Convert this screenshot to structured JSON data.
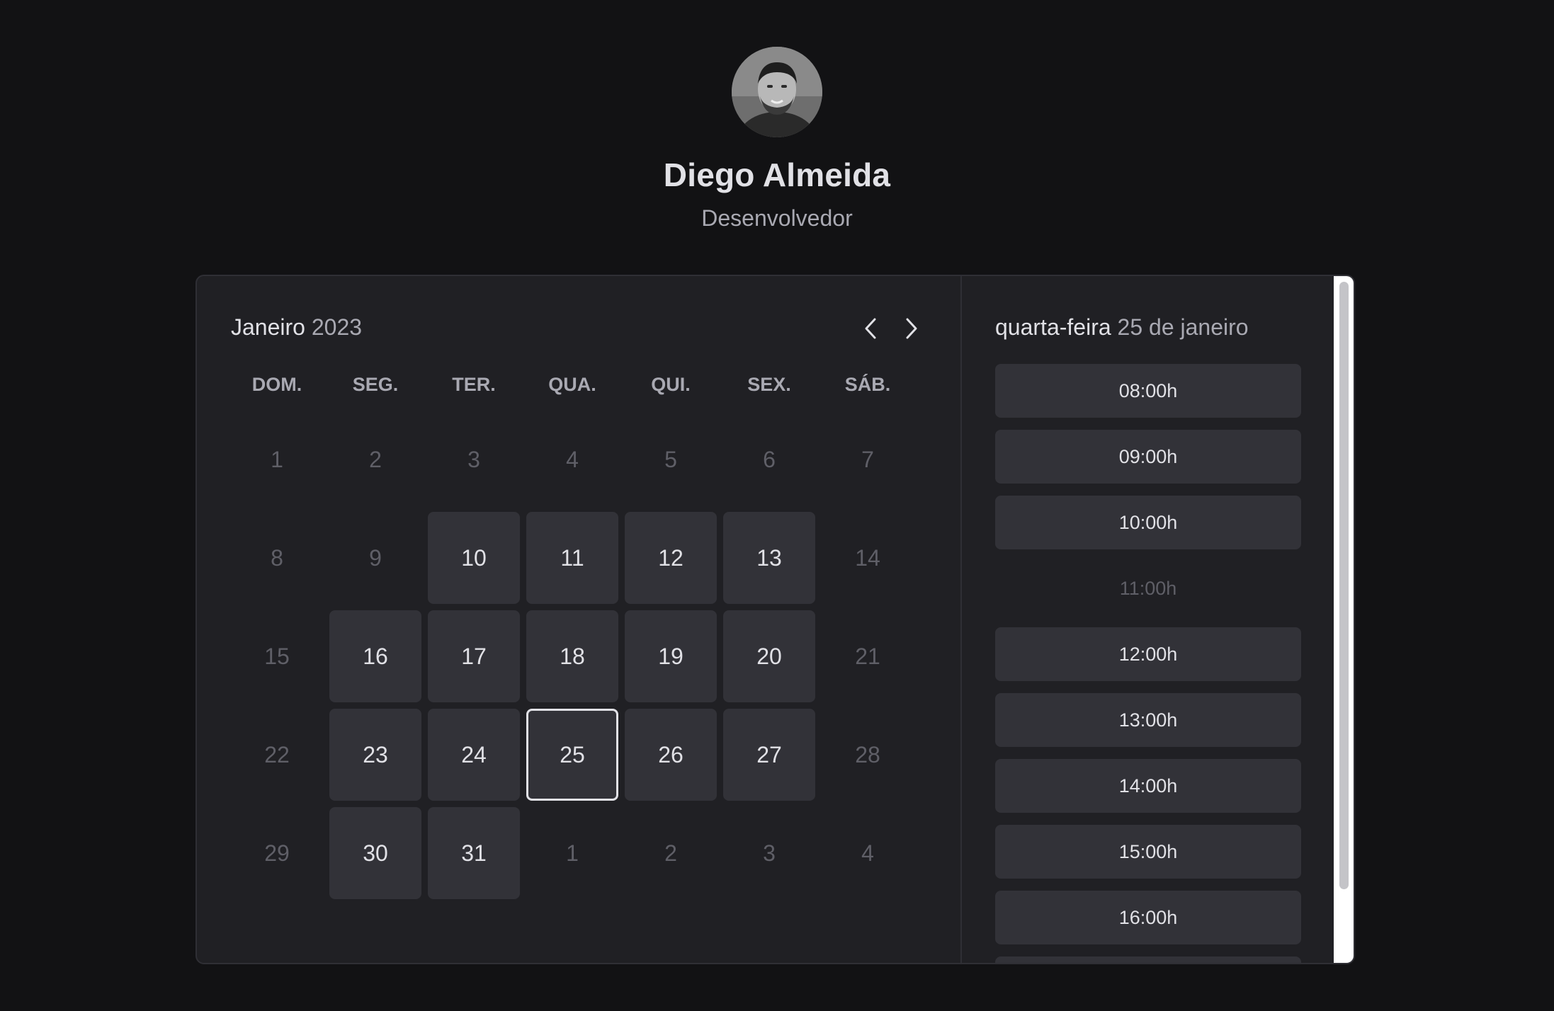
{
  "profile": {
    "name": "Diego Almeida",
    "role": "Desenvolvedor"
  },
  "calendar": {
    "month": "Janeiro",
    "year": "2023",
    "weekdays": [
      "DOM.",
      "SEG.",
      "TER.",
      "QUA.",
      "QUI.",
      "SEX.",
      "SÁB."
    ],
    "weeks": [
      [
        {
          "d": "1",
          "s": "disabled"
        },
        {
          "d": "2",
          "s": "disabled"
        },
        {
          "d": "3",
          "s": "disabled"
        },
        {
          "d": "4",
          "s": "disabled"
        },
        {
          "d": "5",
          "s": "disabled"
        },
        {
          "d": "6",
          "s": "disabled"
        },
        {
          "d": "7",
          "s": "disabled"
        }
      ],
      [
        {
          "d": "8",
          "s": "disabled"
        },
        {
          "d": "9",
          "s": "disabled"
        },
        {
          "d": "10",
          "s": "available"
        },
        {
          "d": "11",
          "s": "available"
        },
        {
          "d": "12",
          "s": "available"
        },
        {
          "d": "13",
          "s": "available"
        },
        {
          "d": "14",
          "s": "disabled"
        }
      ],
      [
        {
          "d": "15",
          "s": "disabled"
        },
        {
          "d": "16",
          "s": "available"
        },
        {
          "d": "17",
          "s": "available"
        },
        {
          "d": "18",
          "s": "available"
        },
        {
          "d": "19",
          "s": "available"
        },
        {
          "d": "20",
          "s": "available"
        },
        {
          "d": "21",
          "s": "disabled"
        }
      ],
      [
        {
          "d": "22",
          "s": "disabled"
        },
        {
          "d": "23",
          "s": "available"
        },
        {
          "d": "24",
          "s": "available"
        },
        {
          "d": "25",
          "s": "selected"
        },
        {
          "d": "26",
          "s": "available"
        },
        {
          "d": "27",
          "s": "available"
        },
        {
          "d": "28",
          "s": "disabled"
        }
      ],
      [
        {
          "d": "29",
          "s": "disabled"
        },
        {
          "d": "30",
          "s": "available"
        },
        {
          "d": "31",
          "s": "available"
        },
        {
          "d": "1",
          "s": "disabled"
        },
        {
          "d": "2",
          "s": "disabled"
        },
        {
          "d": "3",
          "s": "disabled"
        },
        {
          "d": "4",
          "s": "disabled"
        }
      ]
    ]
  },
  "timepicker": {
    "weekday": "quarta-feira",
    "date": "25 de janeiro",
    "slots": [
      {
        "label": "08:00h",
        "available": true
      },
      {
        "label": "09:00h",
        "available": true
      },
      {
        "label": "10:00h",
        "available": true
      },
      {
        "label": "11:00h",
        "available": false
      },
      {
        "label": "12:00h",
        "available": true
      },
      {
        "label": "13:00h",
        "available": true
      },
      {
        "label": "14:00h",
        "available": true
      },
      {
        "label": "15:00h",
        "available": true
      },
      {
        "label": "16:00h",
        "available": true
      },
      {
        "label": "",
        "available": true
      }
    ]
  },
  "icons": {
    "prev": "chevron-left-icon",
    "next": "chevron-right-icon"
  },
  "colors": {
    "background": "#121214",
    "card": "#202024",
    "available": "#323238",
    "text": "#e1e1e6",
    "muted": "#a9a9b2",
    "disabled_text": "#5f5f67"
  }
}
